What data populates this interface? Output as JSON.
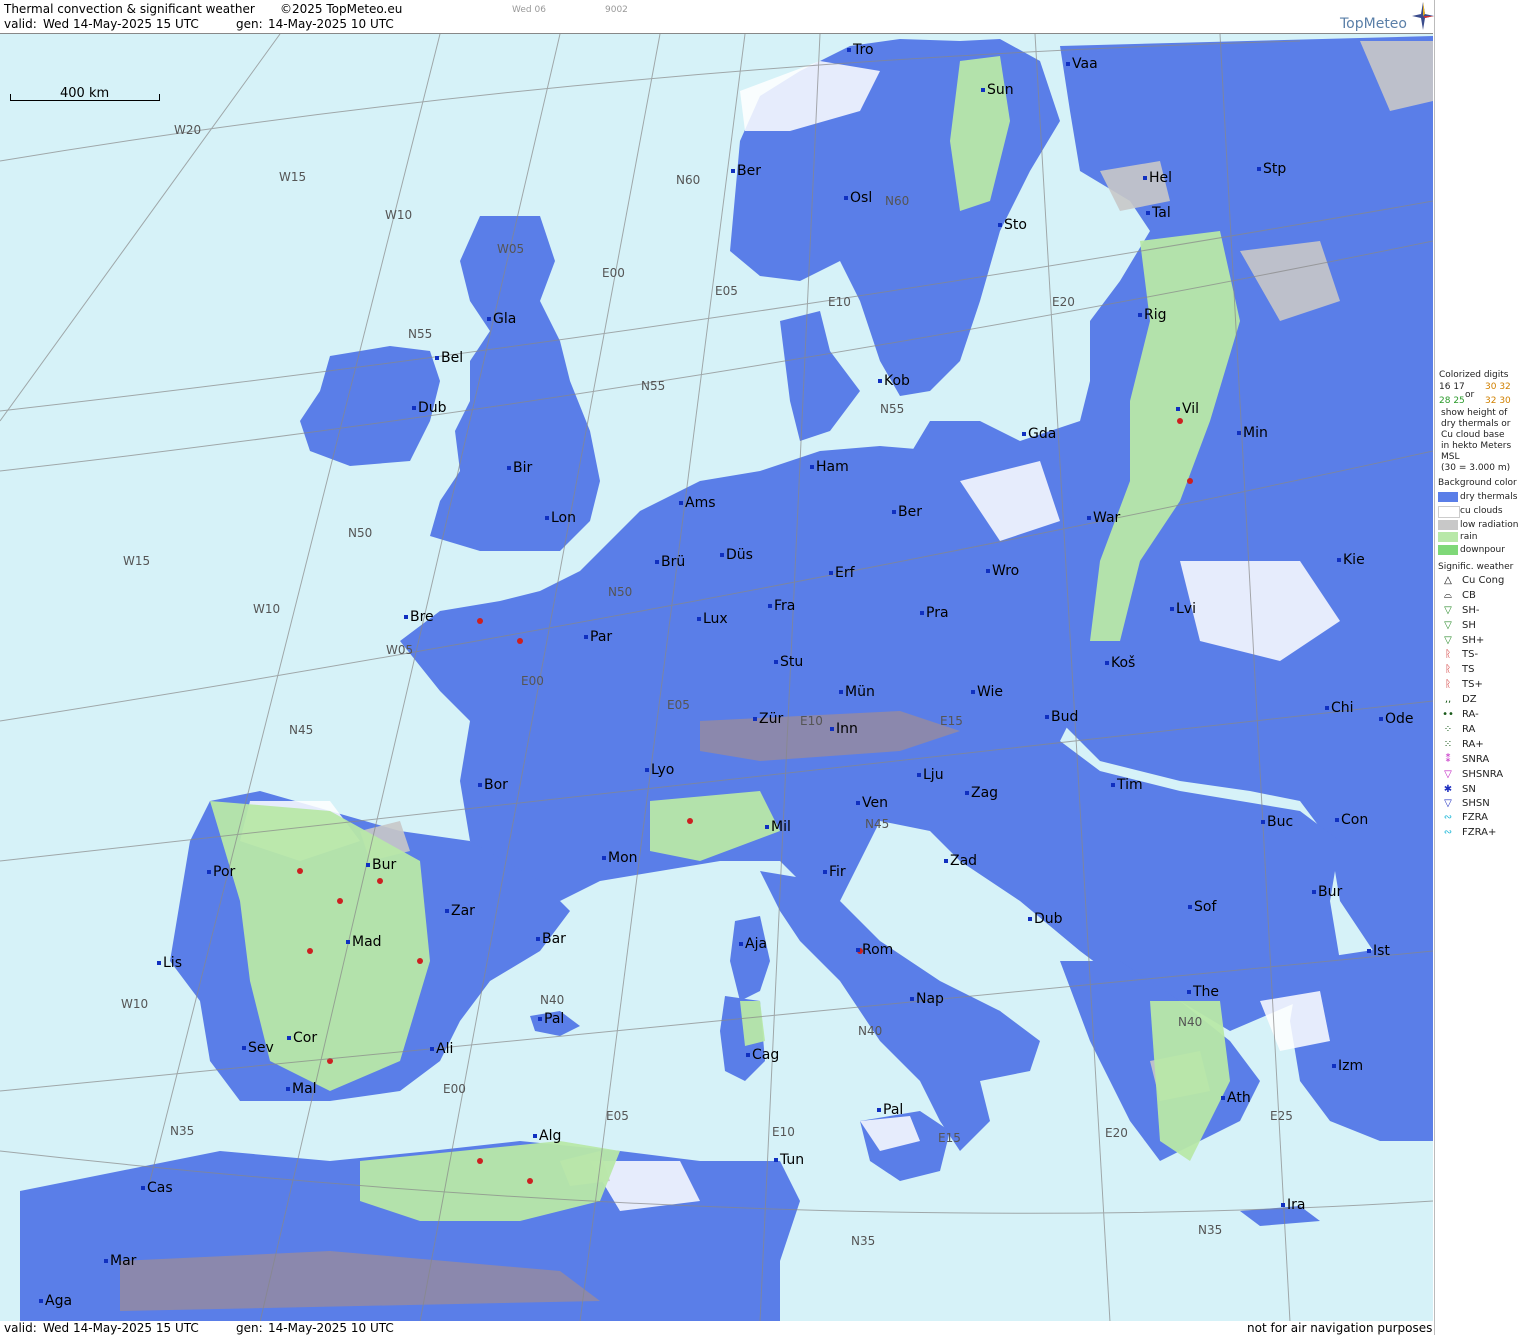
{
  "header": {
    "title": "Thermal convection & significant weather",
    "copyright": "©2025 TopMeteo.eu",
    "valid_label": "valid:",
    "valid_value": "Wed  14-May-2025  15 UTC",
    "gen_label": "gen:",
    "gen_value": "14-May-2025 10 UTC",
    "code1": "Wed 06",
    "code2": "9002"
  },
  "footer": {
    "valid_label": "valid:",
    "valid_value": "Wed  14-May-2025  15 UTC",
    "gen_label": "gen:",
    "gen_value": "14-May-2025 10 UTC",
    "disclaimer": "not for air navigation purposes"
  },
  "logo": {
    "text": "TopMeteo"
  },
  "scale": {
    "label": "400 km"
  },
  "cities": [
    "Tro",
    "Vaa",
    "Ber",
    "Osl",
    "Sun",
    "Sto",
    "Hel",
    "Stp",
    "Tal",
    "Gla",
    "Bel",
    "Dub",
    "Rig",
    "Kob",
    "Gda",
    "Vil",
    "Min",
    "Bir",
    "Ham",
    "Ams",
    "Lon",
    "Ber",
    "War",
    "Brü",
    "Düs",
    "Erf",
    "Wro",
    "Kie",
    "Bre",
    "Par",
    "Lux",
    "Fra",
    "Pra",
    "Lvi",
    "Stu",
    "Koš",
    "Mün",
    "Wie",
    "Bud",
    "Chi",
    "Ode",
    "Zür",
    "Inn",
    "Lyo",
    "Lju",
    "Bor",
    "Mil",
    "Ven",
    "Zag",
    "Tim",
    "Mon",
    "Fir",
    "Zad",
    "Buc",
    "Con",
    "Bur",
    "Por",
    "Zar",
    "Bar",
    "Mad",
    "Aja",
    "Rom",
    "Dub",
    "Sof",
    "Bur",
    "Ist",
    "Lis",
    "Nap",
    "The",
    "Pal",
    "Sev",
    "Cor",
    "Ali",
    "Cag",
    "Mal",
    "Izm",
    "Ath",
    "Alg",
    "Pal",
    "Tun",
    "Cas",
    "Mar",
    "Ira",
    "Aga"
  ],
  "grid_labels": [
    "W20",
    "W15",
    "W10",
    "W05",
    "E00",
    "E05",
    "E10",
    "E20",
    "N60",
    "N60",
    "N55",
    "N55",
    "N50",
    "N55",
    "W15",
    "W10",
    "W05",
    "N50",
    "N45",
    "E00",
    "E05",
    "N45",
    "E15",
    "E10",
    "N40",
    "N40",
    "W10",
    "E00",
    "E05",
    "N40",
    "N35",
    "E10",
    "E15",
    "E20",
    "N35",
    "E25",
    "N35"
  ],
  "legend": {
    "heading": "Colorized digits",
    "sample_a": "16 17",
    "sample_or": "or",
    "sample_b": "30 32",
    "sample_c": "28 25",
    "sample_d": "32 30",
    "desc": [
      "show height of",
      "dry thermals or",
      "Cu cloud base",
      "in hekto Meters",
      "MSL",
      "(30 = 3.000 m)"
    ],
    "bg_heading": "Background color",
    "bg_items": [
      {
        "label": "dry thermals",
        "color": "#5a7ee8"
      },
      {
        "label": "cu clouds",
        "color": "#ffffff"
      },
      {
        "label": "low radiation",
        "color": "#c8c8c8"
      },
      {
        "label": "rain",
        "color": "#b8e8a8"
      },
      {
        "label": "downpour",
        "color": "#7fd878"
      }
    ],
    "wx_heading": "Signific. weather",
    "wx_items": [
      {
        "label": "Cu Cong",
        "icon": "cu-cong-icon"
      },
      {
        "label": "CB",
        "icon": "cb-icon"
      },
      {
        "label": "SH-",
        "icon": "shower-light-icon"
      },
      {
        "label": "SH",
        "icon": "shower-icon"
      },
      {
        "label": "SH+",
        "icon": "shower-heavy-icon"
      },
      {
        "label": "TS-",
        "icon": "thunder-light-icon"
      },
      {
        "label": "TS",
        "icon": "thunder-icon"
      },
      {
        "label": "TS+",
        "icon": "thunder-heavy-icon"
      },
      {
        "label": "DZ",
        "icon": "drizzle-icon"
      },
      {
        "label": "RA-",
        "icon": "rain-light-icon"
      },
      {
        "label": "RA",
        "icon": "rain-icon"
      },
      {
        "label": "RA+",
        "icon": "rain-heavy-icon"
      },
      {
        "label": "SNRA",
        "icon": "snow-rain-icon"
      },
      {
        "label": "SHSNRA",
        "icon": "snow-rain-shower-icon"
      },
      {
        "label": "SN",
        "icon": "snow-icon"
      },
      {
        "label": "SHSN",
        "icon": "snow-shower-icon"
      },
      {
        "label": "FZRA",
        "icon": "freezing-rain-icon"
      },
      {
        "label": "FZRA+",
        "icon": "freezing-rain-heavy-icon"
      }
    ]
  },
  "colors": {
    "sea": "#d6f2f8",
    "dry_thermals": "#5a7ee8",
    "cu_clouds": "#ffffff",
    "low_radiation": "#c8c8c8",
    "rain": "#b8e8a8",
    "downpour": "#7fd878",
    "thunder": "#cc2020"
  }
}
